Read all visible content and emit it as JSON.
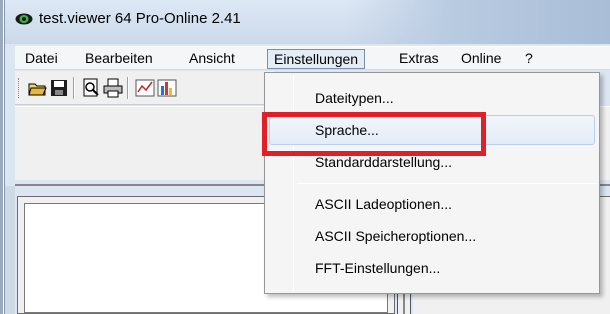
{
  "window": {
    "title": "test.viewer 64 Pro-Online 2.41"
  },
  "menubar": {
    "items": [
      {
        "label": "Datei"
      },
      {
        "label": "Bearbeiten"
      },
      {
        "label": "Ansicht"
      },
      {
        "label": "Einstellungen"
      },
      {
        "label": "Extras"
      },
      {
        "label": "Online"
      },
      {
        "label": "?"
      }
    ]
  },
  "toolbar": {
    "buttons": [
      "open-folder-icon",
      "save-icon",
      "print-preview-icon",
      "print-icon",
      "chart-icon",
      "colorbar-icon"
    ]
  },
  "dropdown": {
    "items": [
      {
        "label": "Dateitypen..."
      },
      {
        "label": "Sprache..."
      },
      {
        "label": "Standarddarstellung..."
      },
      {
        "label": "ASCII Ladeoptionen..."
      },
      {
        "label": "ASCII Speicheroptionen..."
      },
      {
        "label": "FFT-Einstellungen..."
      }
    ],
    "hovered_index": 1
  },
  "colors": {
    "highlight": "#e01f26",
    "titlebar": "#cbd9ea",
    "menu_bg": "#f5f5f5"
  }
}
